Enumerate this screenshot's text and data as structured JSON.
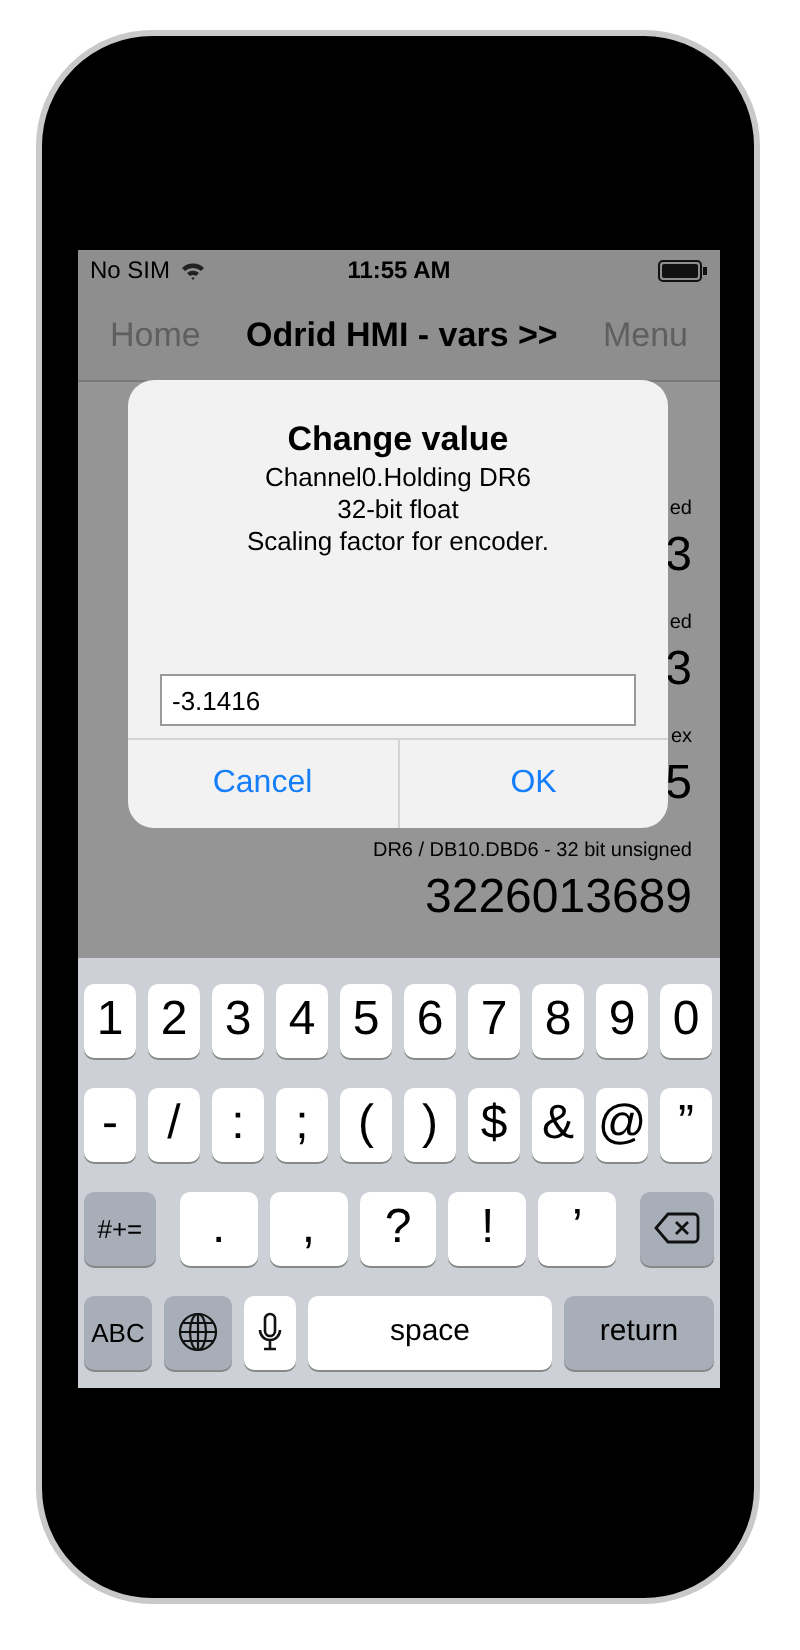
{
  "status_bar": {
    "carrier": "No SIM",
    "time": "11:55 AM"
  },
  "nav": {
    "back": "Home",
    "title": "Odrid HMI - vars >>",
    "menu": "Menu"
  },
  "rows": [
    {
      "label": "ed",
      "value": "3"
    },
    {
      "label": "ed",
      "value": "3"
    },
    {
      "label": "ex",
      "value": "5"
    },
    {
      "label": "DR6 / DB10.DBD6 - 32 bit unsigned",
      "value": "3226013689"
    }
  ],
  "dialog": {
    "title": "Change value",
    "lines": [
      "Channel0.Holding DR6",
      "32-bit float",
      "Scaling factor for encoder."
    ],
    "value": "-3.1416",
    "buttons": [
      {
        "label": "Cancel",
        "bold": false
      },
      {
        "label": "OK",
        "bold": false
      }
    ]
  },
  "keyboard": [
    [
      {
        "kind": "char",
        "label": "1"
      },
      {
        "kind": "char",
        "label": "2"
      },
      {
        "kind": "char",
        "label": "3"
      },
      {
        "kind": "char",
        "label": "4"
      },
      {
        "kind": "char",
        "label": "5"
      },
      {
        "kind": "char",
        "label": "6"
      },
      {
        "kind": "char",
        "label": "7"
      },
      {
        "kind": "char",
        "label": "8"
      },
      {
        "kind": "char",
        "label": "9"
      },
      {
        "kind": "char",
        "label": "0"
      }
    ],
    [
      {
        "kind": "char",
        "label": "-"
      },
      {
        "kind": "char",
        "label": "/"
      },
      {
        "kind": "char",
        "label": ":"
      },
      {
        "kind": "char",
        "label": ";"
      },
      {
        "kind": "char",
        "label": "("
      },
      {
        "kind": "char",
        "label": ")"
      },
      {
        "kind": "char",
        "label": "$"
      },
      {
        "kind": "char",
        "label": "&"
      },
      {
        "kind": "char",
        "label": "@"
      },
      {
        "kind": "char",
        "label": "”"
      }
    ],
    [
      {
        "kind": "function",
        "label": "#+="
      },
      {
        "kind": "wide",
        "label": "."
      },
      {
        "kind": "wide",
        "label": ","
      },
      {
        "kind": "wide",
        "label": "?"
      },
      {
        "kind": "wide",
        "label": "!"
      },
      {
        "kind": "wide",
        "label": "’"
      },
      {
        "kind": "delete"
      }
    ],
    [
      {
        "kind": "function",
        "label": "ABC"
      },
      {
        "kind": "globe"
      },
      {
        "kind": "mic"
      },
      {
        "kind": "space",
        "label": "space"
      },
      {
        "kind": "return",
        "label": "return"
      }
    ]
  ]
}
